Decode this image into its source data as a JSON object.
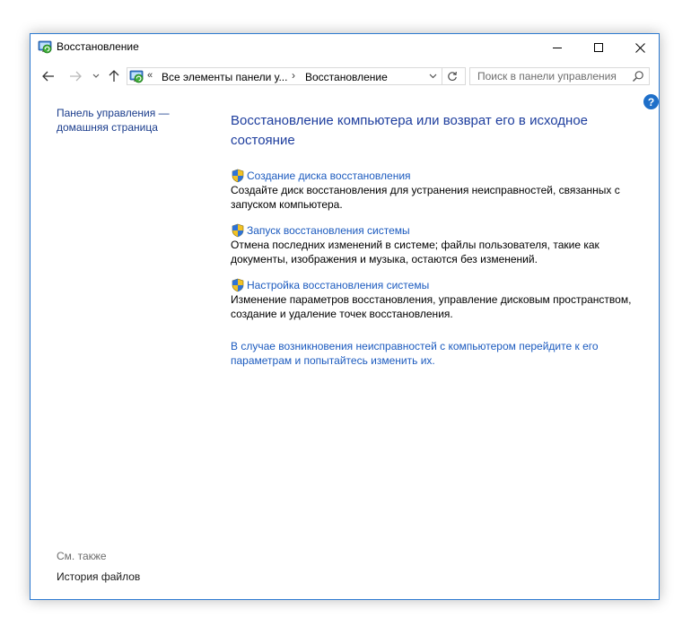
{
  "window": {
    "title": "Восстановление",
    "controls": {
      "minimize": "minimize-icon",
      "maximize": "maximize-icon",
      "close": "close-icon"
    }
  },
  "navigation": {
    "back": "arrow-left-icon",
    "forward": "arrow-right-icon",
    "recent": "chevron-down-icon",
    "up": "arrow-up-icon"
  },
  "address_bar": {
    "overflow": "«",
    "crumbs": [
      "Все элементы панели у...",
      "Восстановление"
    ],
    "separator": "›"
  },
  "search": {
    "placeholder": "Поиск в панели управления",
    "value": ""
  },
  "help": {
    "label": "?"
  },
  "sidebar": {
    "home_link": "Панель управления — домашняя страница",
    "see_also_heading": "См. также",
    "see_also_items": [
      "История файлов"
    ]
  },
  "main": {
    "title": "Восстановление компьютера или возврат его в исходное состояние",
    "tasks": [
      {
        "link": "Создание диска восстановления",
        "description": "Создайте диск восстановления для устранения неисправностей, связанных с запуском компьютера."
      },
      {
        "link": "Запуск восстановления системы",
        "description": "Отмена последних изменений в системе; файлы пользователя, такие как документы, изображения и музыка, остаются без изменений."
      },
      {
        "link": "Настройка восстановления системы",
        "description": "Изменение параметров восстановления, управление дисковым пространством, создание и удаление точек восстановления."
      }
    ],
    "footer_link": "В случае возникновения неисправностей с компьютером перейдите к его параметрам и попытайтесь изменить их."
  },
  "colors": {
    "window_border": "#2b79d0",
    "title_blue": "#1e3e9e",
    "link_blue": "#1c5bbf",
    "help_blue": "#1e6fc9"
  }
}
